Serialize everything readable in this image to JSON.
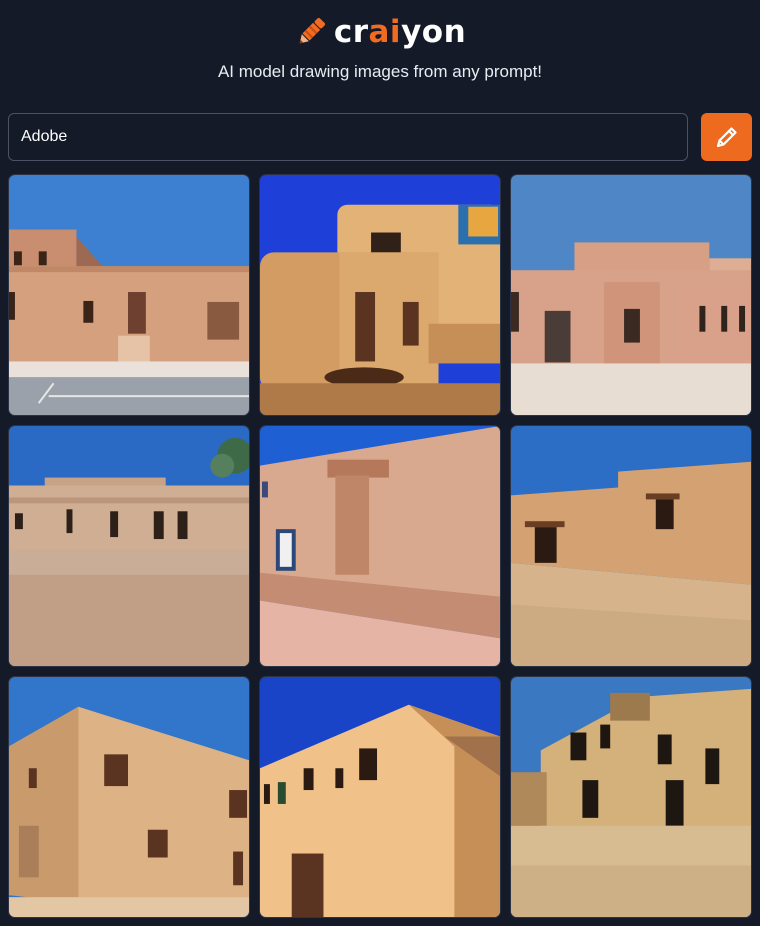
{
  "brand": {
    "prefix": "cr",
    "highlight": "ai",
    "suffix": "yon",
    "accent_color": "#f26b21",
    "icon": "crayon-icon"
  },
  "tagline": "AI model drawing images from any prompt!",
  "prompt": {
    "value": "Adobe",
    "placeholder": ""
  },
  "draw_button": {
    "icon": "pencil-icon",
    "color": "#ed6a1f"
  },
  "results": {
    "count": 9,
    "subject": "adobe building"
  }
}
